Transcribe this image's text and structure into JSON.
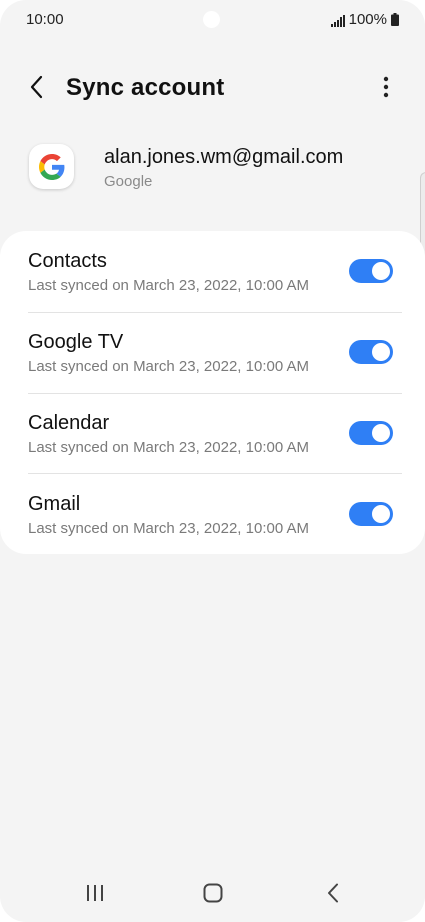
{
  "status_bar": {
    "time": "10:00",
    "battery": "100%"
  },
  "header": {
    "title": "Sync account"
  },
  "account": {
    "email": "alan.jones.wm@gmail.com",
    "provider": "Google"
  },
  "sync_items": [
    {
      "title": "Contacts",
      "subtitle": "Last synced on March 23, 2022, 10:00 AM",
      "enabled": true
    },
    {
      "title": "Google TV",
      "subtitle": "Last synced on March 23, 2022, 10:00 AM",
      "enabled": true
    },
    {
      "title": "Calendar",
      "subtitle": "Last synced on March 23, 2022, 10:00 AM",
      "enabled": true
    },
    {
      "title": "Gmail",
      "subtitle": "Last synced on March 23, 2022, 10:00 AM",
      "enabled": true
    }
  ],
  "icons": {
    "back": "chevron-left-icon",
    "more": "more-vertical-icon",
    "account_logo": "google-logo-icon",
    "recents": "recent-apps-icon",
    "home": "home-icon",
    "nav_back": "nav-back-icon",
    "signal": "signal-icon",
    "battery": "battery-icon"
  },
  "colors": {
    "accent": "#2f7ff5",
    "background": "#f4f4f4",
    "card": "#ffffff"
  }
}
